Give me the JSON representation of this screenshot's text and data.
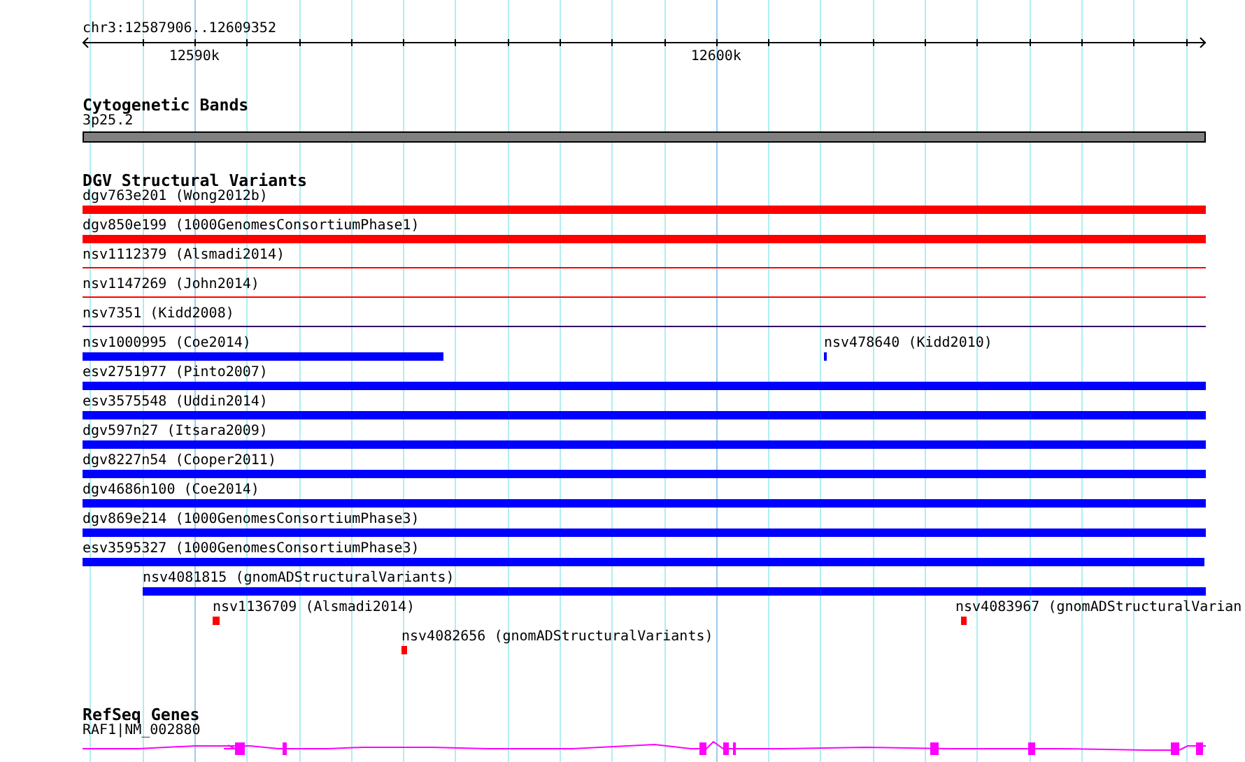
{
  "region": "chr3:12587906..12609352",
  "ruler": {
    "tick_labels": [
      "12590k",
      "12600k"
    ]
  },
  "tracks": [
    {
      "kind": "bands",
      "title": "Cytogenetic Bands",
      "label": "3p25.2"
    },
    {
      "kind": "variants",
      "title": "DGV Structural Variants",
      "lanes": [
        [
          {
            "label": "dgv763e201 (Wong2012b)",
            "color": "#ff0000",
            "kind": "bar"
          }
        ],
        [
          {
            "label": "dgv850e199 (1000GenomesConsortiumPhase1)",
            "color": "#ff0000",
            "kind": "bar"
          }
        ],
        [
          {
            "label": "nsv1112379 (Alsmadi2014)",
            "color": "#ff0000",
            "kind": "line"
          }
        ],
        [
          {
            "label": "nsv1147269 (John2014)",
            "color": "#ff0000",
            "kind": "line"
          }
        ],
        [
          {
            "label": "nsv7351 (Kidd2008)",
            "color": "#330066",
            "kind": "line"
          }
        ],
        [
          {
            "label": "nsv1000995 (Coe2014)",
            "color": "#0000ff",
            "kind": "bar"
          },
          {
            "label": "nsv478640 (Kidd2010)",
            "color": "#0000ff",
            "kind": "bar"
          }
        ],
        [
          {
            "label": "esv2751977 (Pinto2007)",
            "color": "#0000ff",
            "kind": "bar"
          }
        ],
        [
          {
            "label": "esv3575548 (Uddin2014)",
            "color": "#0000ff",
            "kind": "bar"
          }
        ],
        [
          {
            "label": "dgv597n27 (Itsara2009)",
            "color": "#0000ff",
            "kind": "bar"
          }
        ],
        [
          {
            "label": "dgv8227n54 (Cooper2011)",
            "color": "#0000ff",
            "kind": "bar"
          }
        ],
        [
          {
            "label": "dgv4686n100 (Coe2014)",
            "color": "#0000ff",
            "kind": "bar"
          }
        ],
        [
          {
            "label": "dgv869e214 (1000GenomesConsortiumPhase3)",
            "color": "#0000ff",
            "kind": "bar"
          }
        ],
        [
          {
            "label": "esv3595327 (1000GenomesConsortiumPhase3)",
            "color": "#0000ff",
            "kind": "bar"
          }
        ],
        [
          {
            "label": "nsv4081815 (gnomADStructuralVariants)",
            "color": "#0000ff",
            "kind": "bar"
          }
        ],
        [
          {
            "label": "nsv1136709 (Alsmadi2014)",
            "color": "#ff0000",
            "kind": "bar"
          },
          {
            "label": "nsv4083967 (gnomADStructuralVarian",
            "color": "#ff0000",
            "kind": "bar"
          }
        ],
        [
          {
            "label": "nsv4082656 (gnomADStructuralVariants)",
            "color": "#ff0000",
            "kind": "bar"
          }
        ]
      ]
    },
    {
      "kind": "genes",
      "title": "RefSeq Genes",
      "label": "RAF1|NM_002880"
    }
  ]
}
